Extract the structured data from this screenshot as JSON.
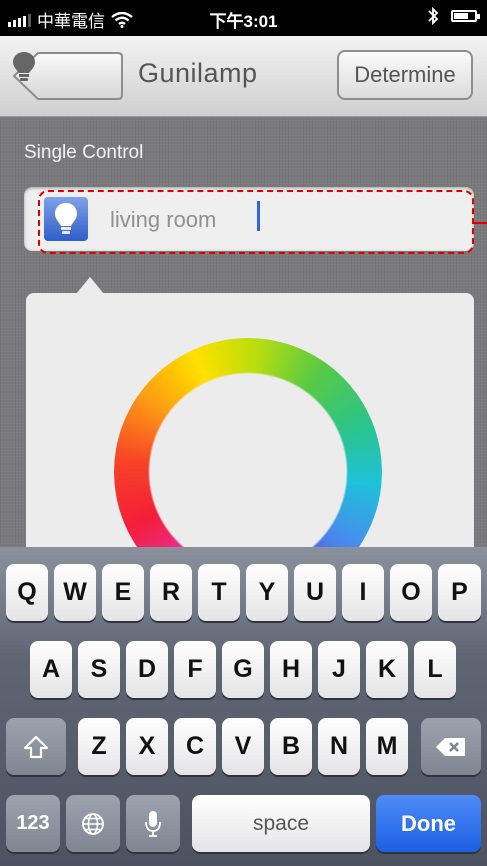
{
  "status_bar": {
    "carrier": "中華電信",
    "time": "下午3:01",
    "icons": [
      "signal-icon",
      "wifi-icon",
      "bluetooth-icon",
      "battery-icon"
    ]
  },
  "nav": {
    "title": "Gunilamp",
    "determine_label": "Determine"
  },
  "content": {
    "section_label": "Single Control",
    "device_name": "living room"
  },
  "keyboard": {
    "row1": [
      "Q",
      "W",
      "E",
      "R",
      "T",
      "Y",
      "U",
      "I",
      "O",
      "P"
    ],
    "row2": [
      "A",
      "S",
      "D",
      "F",
      "G",
      "H",
      "J",
      "K",
      "L"
    ],
    "row3": [
      "Z",
      "X",
      "C",
      "V",
      "B",
      "N",
      "M"
    ],
    "numbers_label": "123",
    "space_label": "space",
    "done_label": "Done"
  },
  "colors": {
    "highlight": "#e00000",
    "done_key": "#1c5fe2",
    "caret": "#2f66e6"
  }
}
